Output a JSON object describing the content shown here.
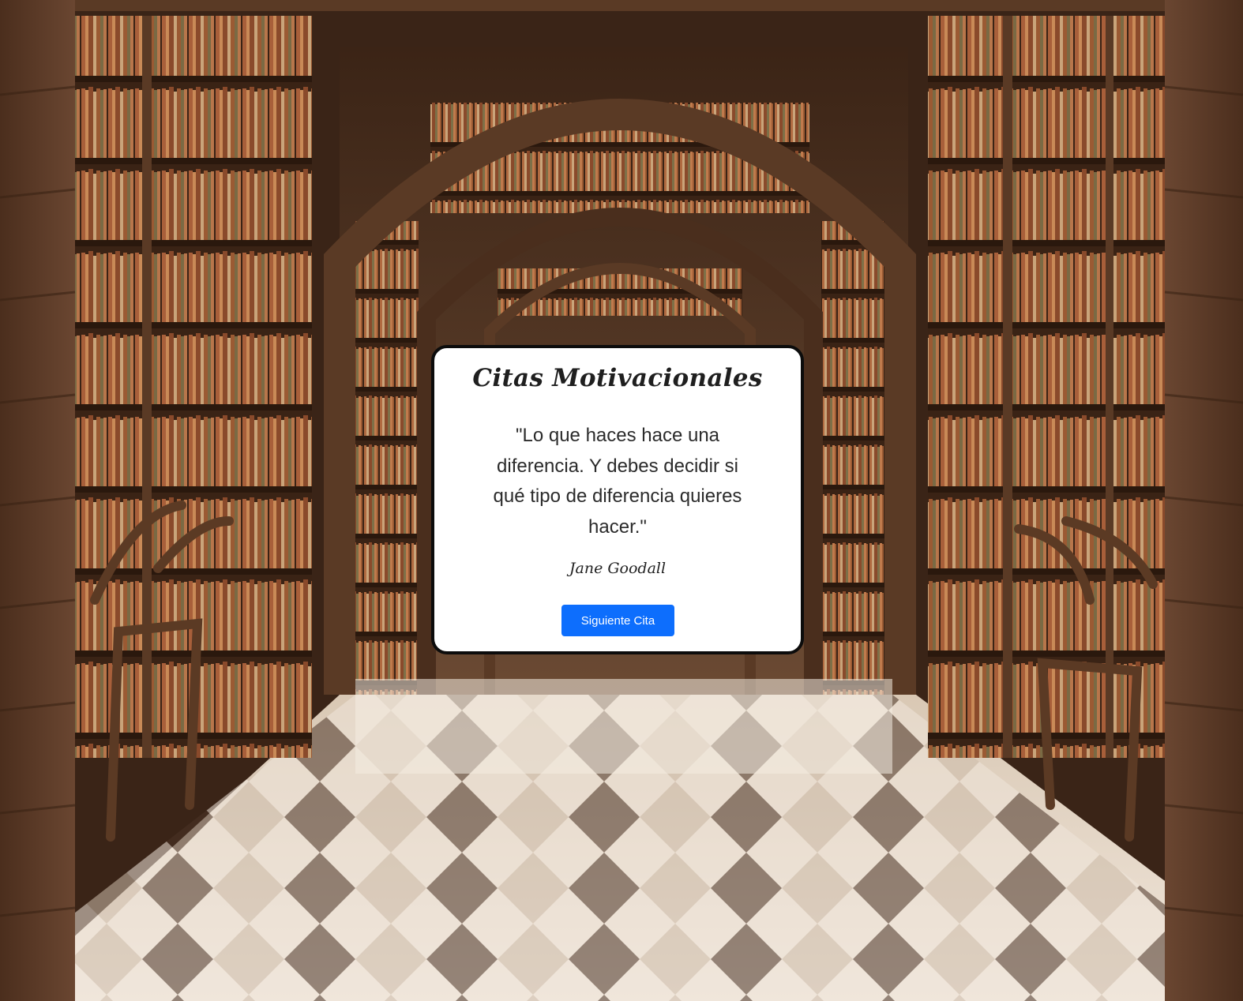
{
  "background": {
    "image": "library-hallway-with-bookshelves-and-arches"
  },
  "quote_card": {
    "title": "Citas Motivacionales",
    "quote": "\"Lo que haces hace una diferencia. Y debes decidir si qué tipo de diferencia quieres hacer.\"",
    "author": "Jane Goodall",
    "next_button_label": "Siguiente Cita"
  },
  "colors": {
    "button": "#0d6efd",
    "card_background": "#ffffff",
    "card_border": "#0c0c0c"
  }
}
